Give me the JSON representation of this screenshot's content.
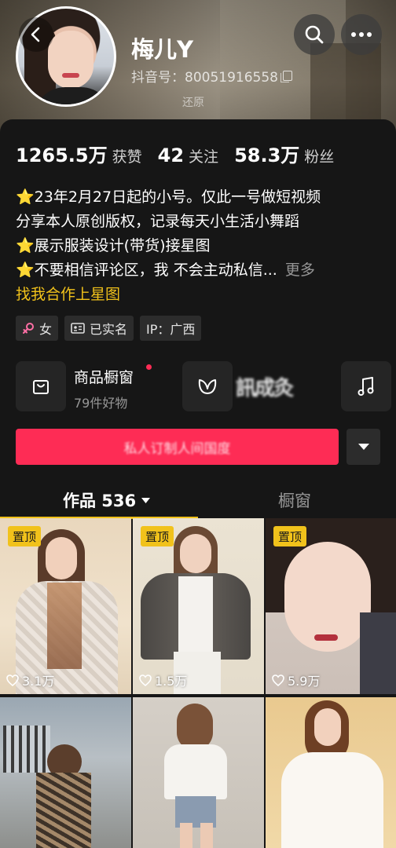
{
  "profile": {
    "nickname": "梅儿Y",
    "douyin_id": "抖音号：80051916558",
    "restore_label": "还原"
  },
  "stats": [
    {
      "value": "1265.5万",
      "label": "获赞"
    },
    {
      "value": "42",
      "label": "关注"
    },
    {
      "value": "58.3万",
      "label": "粉丝"
    }
  ],
  "bio": {
    "line1": "⭐23年2月27日起的小号。仅此一号做短视频",
    "line2": "分享本人原创版权，记录每天小生活小舞蹈",
    "line3": "⭐展示服装设计(带货)接星图",
    "line4": "⭐不要相信评论区，我 不会主动私信...",
    "more": "更多",
    "cooperation": "找我合作上星图"
  },
  "tags": {
    "gender": "女",
    "verified": "已实名",
    "ip": "IP：广西"
  },
  "shop": {
    "title": "商品橱窗",
    "subtitle": "79件好物"
  },
  "tabs": {
    "works": "作品 536",
    "window": "橱窗"
  },
  "videos": [
    {
      "pinned_label": "置顶",
      "likes": "3.1万"
    },
    {
      "pinned_label": "置顶",
      "likes": "1.5万"
    },
    {
      "pinned_label": "置顶",
      "likes": "5.9万"
    },
    {
      "pinned_label": "",
      "likes": ""
    },
    {
      "pinned_label": "",
      "likes": ""
    },
    {
      "pinned_label": "",
      "likes": ""
    }
  ],
  "colors": {
    "accent_red": "#fe2c55",
    "pin_yellow": "#f1c21b",
    "background": "#161616"
  }
}
